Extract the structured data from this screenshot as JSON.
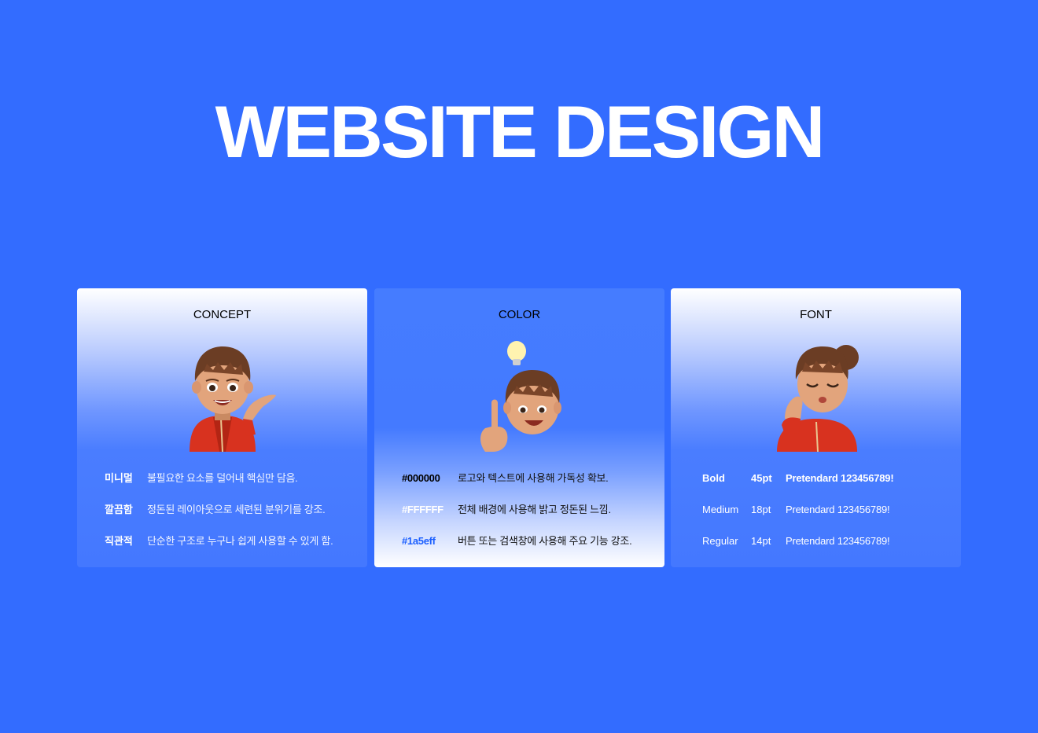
{
  "page_title": "WEBSITE DESIGN",
  "colors": {
    "background": "#336cff",
    "accent": "#1a5eff"
  },
  "cards": [
    {
      "title": "CONCEPT",
      "icon": "memoji-presenting-icon",
      "rows": [
        {
          "label": "미니멀",
          "text": "불필요한 요소를 덜어내 핵심만 담음."
        },
        {
          "label": "깔끔함",
          "text": "정돈된 레이아웃으로 세련된 분위기를 강조."
        },
        {
          "label": "직관적",
          "text": "단순한 구조로 누구나 쉽게 사용할 수 있게 함."
        }
      ]
    },
    {
      "title": "COLOR",
      "icon": "memoji-idea-icon",
      "rows": [
        {
          "code": "#000000",
          "code_color": "#000000",
          "text": "로고와 텍스트에 사용해 가독성 확보."
        },
        {
          "code": "#FFFFFF",
          "code_color": "#FFFFFF",
          "text": "전체 배경에 사용해 밝고 정돈된 느낌."
        },
        {
          "code": "#1a5eff",
          "code_color": "#1a5eff",
          "text": "버튼 또는 검색창에 사용해 주요 기능 강조."
        }
      ]
    },
    {
      "title": "FONT",
      "icon": "memoji-kiss-icon",
      "rows": [
        {
          "weight": "Bold",
          "size": "45pt",
          "sample": "Pretendard 123456789!"
        },
        {
          "weight": "Medium",
          "size": "18pt",
          "sample": "Pretendard 123456789!"
        },
        {
          "weight": "Regular",
          "size": "14pt",
          "sample": "Pretendard 123456789!"
        }
      ]
    }
  ]
}
